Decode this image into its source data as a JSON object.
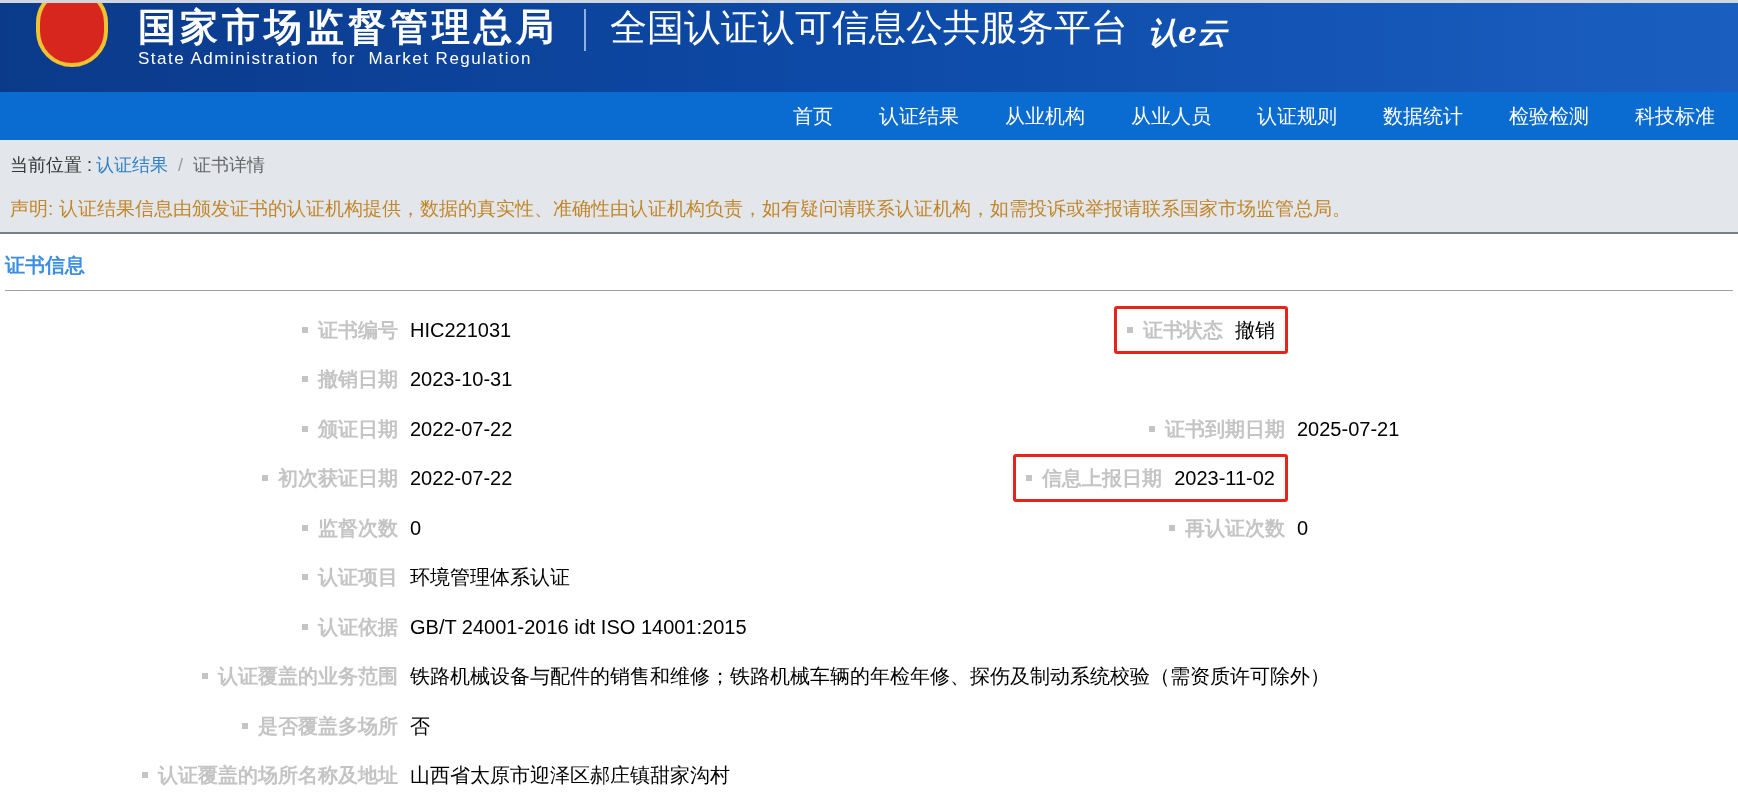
{
  "header": {
    "agency_cn": "国家市场监督管理总局",
    "agency_en": "State Administration  for  Market Regulation",
    "platform": "全国认证认可信息公共服务平台",
    "logo_text": "认e云"
  },
  "nav": [
    {
      "label": "首页",
      "selected": false
    },
    {
      "label": "认证结果",
      "selected": false
    },
    {
      "label": "从业机构",
      "selected": false
    },
    {
      "label": "从业人员",
      "selected": false
    },
    {
      "label": "认证规则",
      "selected": false
    },
    {
      "label": "数据统计",
      "selected": false
    },
    {
      "label": "检验检测",
      "selected": false
    },
    {
      "label": "科技标准",
      "selected": false
    }
  ],
  "breadcrumb": {
    "prefix": "当前位置 :",
    "separator": "/",
    "items": [
      {
        "label": "认证结果",
        "link": true
      },
      {
        "label": "证书详情",
        "link": false
      }
    ]
  },
  "notice": "声明: 认证结果信息由颁发证书的认证机构提供，数据的真实性、准确性由认证机构负责，如有疑问请联系认证机构，如需投诉或举报请联系国家市场监管总局。",
  "section_title": "证书信息",
  "rows": [
    {
      "left": {
        "label": "证书编号",
        "value": "HIC221031"
      },
      "right": {
        "label": "证书状态",
        "value": "撤销",
        "highlighted": true
      }
    },
    {
      "left": {
        "label": "撤销日期",
        "value": "2023-10-31"
      }
    },
    {
      "left": {
        "label": "颁证日期",
        "value": "2022-07-22"
      },
      "right": {
        "label": "证书到期日期",
        "value": "2025-07-21",
        "highlighted": false
      }
    },
    {
      "left": {
        "label": "初次获证日期",
        "value": "2022-07-22"
      },
      "right": {
        "label": "信息上报日期",
        "value": "2023-11-02",
        "highlighted": true
      }
    },
    {
      "left": {
        "label": "监督次数",
        "value": "0"
      },
      "right": {
        "label": "再认证次数",
        "value": "0",
        "highlighted": false
      }
    },
    {
      "left": {
        "label": "认证项目",
        "value": "环境管理体系认证"
      }
    },
    {
      "left": {
        "label": "认证依据",
        "value": "GB/T 24001-2016 idt ISO 14001:2015"
      }
    },
    {
      "left": {
        "label": "认证覆盖的业务范围",
        "value": "铁路机械设备与配件的销售和维修；铁路机械车辆的年检年修、探伤及制动系统校验（需资质许可除外）"
      }
    },
    {
      "left": {
        "label": "是否覆盖多场所",
        "value": "否"
      }
    },
    {
      "left": {
        "label": "认证覆盖的场所名称及地址",
        "value": "山西省太原市迎泽区郝庄镇甜家沟村"
      }
    }
  ]
}
